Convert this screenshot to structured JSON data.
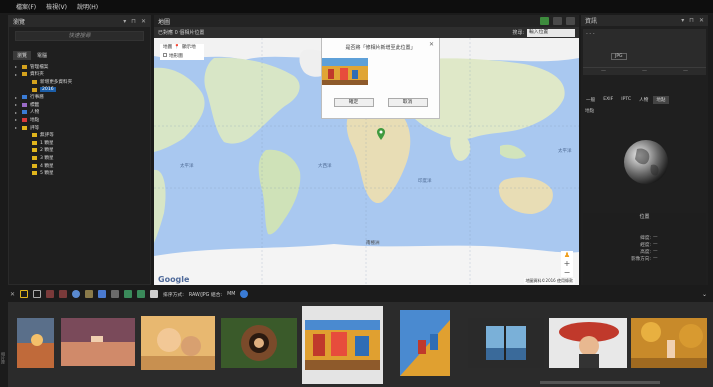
{
  "menu": [
    "檔案(F)",
    "檢視(V)",
    "說明(H)"
  ],
  "left_panel": {
    "title": "瀏覽",
    "search_placeholder": "快速搜尋",
    "tabs": [
      "瀏覽",
      "電腦"
    ],
    "tree": [
      {
        "label": "管理檔案",
        "indent": 0,
        "color": "#d4a21d"
      },
      {
        "label": "資料夾",
        "indent": 0,
        "color": "#d4a21d"
      },
      {
        "label": "新增更多資料夾",
        "indent": 1,
        "color": "#d4a21d"
      },
      {
        "label": "2016",
        "indent": 1,
        "color": "#d4a21d",
        "selected": true
      },
      {
        "label": "行事曆",
        "indent": 0,
        "color": "#3a7bd5"
      },
      {
        "label": "標籤",
        "indent": 0,
        "color": "#9a6bc7"
      },
      {
        "label": "人物",
        "indent": 0,
        "color": "#3a7bd5"
      },
      {
        "label": "地點",
        "indent": 0,
        "color": "#d83a3a"
      },
      {
        "label": "評等",
        "indent": 0,
        "color": "#e0b51c"
      },
      {
        "label": "無評等",
        "indent": 1,
        "color": "#e0b51c"
      },
      {
        "label": "1 顆星",
        "indent": 1,
        "color": "#e0b51c"
      },
      {
        "label": "2 顆星",
        "indent": 1,
        "color": "#e0b51c"
      },
      {
        "label": "3 顆星",
        "indent": 1,
        "color": "#e0b51c"
      },
      {
        "label": "4 顆星",
        "indent": 1,
        "color": "#e0b51c"
      },
      {
        "label": "5 顆星",
        "indent": 1,
        "color": "#e0b51c"
      }
    ]
  },
  "center": {
    "title": "地圖",
    "status": "已對應 0 個相片位置",
    "search_label": "搜尋:",
    "search_value": "輸入位置",
    "map_type": [
      "地圖",
      "地形圖"
    ],
    "map_type_hint": "顯示地",
    "dialog": {
      "question": "是否將「修相片新增至此位置」",
      "ok": "確定",
      "cancel": "取消"
    },
    "labels": [
      "大西洋",
      "太平洋",
      "太平洋",
      "大西洋",
      "印度洋",
      "太平洋",
      "南極洲"
    ],
    "attribution": "地圖資料©2016",
    "terms": "使用條款",
    "google": "Google"
  },
  "right_panel": {
    "title": "資訊",
    "file_text": "- - -",
    "format": "JPG",
    "bar": [
      "—",
      "—",
      "—"
    ],
    "tabs": [
      "一般",
      "EXIF",
      "IPTC",
      "人物",
      "地點"
    ],
    "active_tab": "地點",
    "subtitle": "地點",
    "location_title": "位置",
    "fields": [
      {
        "k": "緯度:",
        "v": "—"
      },
      {
        "k": "經度:",
        "v": "—"
      },
      {
        "k": "高度:",
        "v": "—"
      },
      {
        "k": "影像方向:",
        "v": "—"
      }
    ]
  },
  "toolbar": {
    "sort_label": "排序方式:",
    "raw_label": "RAW/JPG 組合:",
    "raw_value": "MM"
  },
  "strip": {
    "side_label": "相片匣"
  }
}
